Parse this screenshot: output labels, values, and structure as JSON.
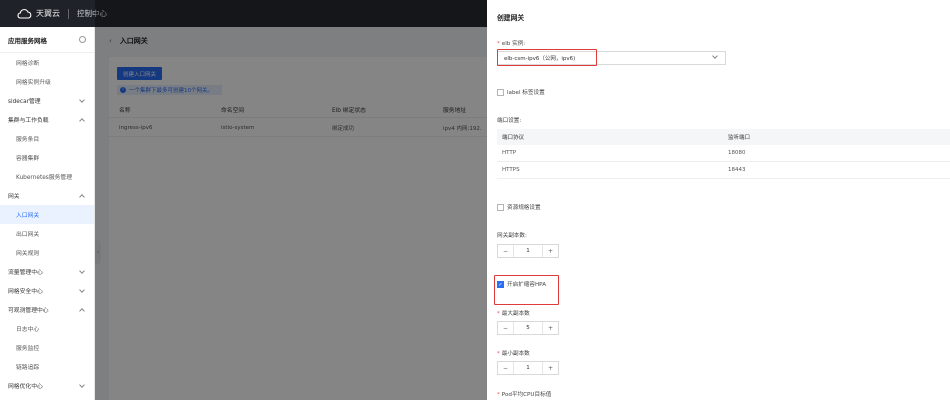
{
  "topbar": {
    "brand": "天翼云",
    "console": "控制中心"
  },
  "sidebar": {
    "title": "应用服务网格",
    "items": [
      {
        "label": "网格诊断",
        "sub": true
      },
      {
        "label": "网格实例升级",
        "sub": true
      },
      {
        "label": "sidecar管理",
        "chevron": "down"
      },
      {
        "label": "集群与工作负载",
        "chevron": "up"
      },
      {
        "label": "服务条目",
        "sub": true
      },
      {
        "label": "容器集群",
        "sub": true
      },
      {
        "label": "Kubernetes服务管理",
        "sub": true
      },
      {
        "label": "网关",
        "chevron": "up"
      },
      {
        "label": "入口网关",
        "sub": true,
        "active": true
      },
      {
        "label": "出口网关",
        "sub": true
      },
      {
        "label": "网关规则",
        "sub": true
      },
      {
        "label": "流量管理中心",
        "chevron": "down"
      },
      {
        "label": "网格安全中心",
        "chevron": "down"
      },
      {
        "label": "可观测管理中心",
        "chevron": "up"
      },
      {
        "label": "日志中心",
        "sub": true
      },
      {
        "label": "服务监控",
        "sub": true
      },
      {
        "label": "链路追踪",
        "sub": true
      },
      {
        "label": "网格优化中心",
        "chevron": "down"
      }
    ]
  },
  "main": {
    "title": "入口网关",
    "create_button": "创建入口网关",
    "info": "一个集群下最多可创建10个网关。",
    "columns": [
      "名称",
      "命名空间",
      "Elb 绑定状态",
      "服务地址"
    ],
    "rows": [
      [
        "ingress-ipv6",
        "istio-system",
        "绑定成功",
        "ipv4 内网:192."
      ]
    ]
  },
  "drawer": {
    "title": "创建网关",
    "elb_label": "elb 实例:",
    "elb_value": "elb-csm-ipv6（公网，ipv6)",
    "label_settings": "label 标签设置",
    "port_settings_label": "端口设置:",
    "port_columns": [
      "端口协议",
      "监听端口"
    ],
    "port_rows": [
      [
        "HTTP",
        "18080"
      ],
      [
        "HTTPS",
        "18443"
      ]
    ],
    "resource_settings": "资源规格设置",
    "replicas_label": "网关副本数:",
    "replicas_value": "1",
    "hpa_label": "开启扩缩容HPA",
    "max_replicas_label": "最大副本数",
    "max_replicas_value": "5",
    "min_replicas_label": "最小副本数",
    "min_replicas_value": "1",
    "cpu_label": "Pod平均CPU目标值",
    "minus": "−",
    "plus": "+"
  },
  "colors": {
    "accent": "#2a6ef5",
    "highlight": "#e03b3b",
    "topbar": "#1f2329"
  }
}
